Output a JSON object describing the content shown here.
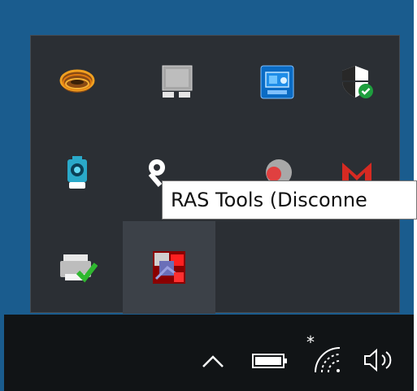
{
  "tooltip": {
    "text": "RAS Tools (Disconne"
  },
  "tray_icons": [
    {
      "name": "ring-app-icon"
    },
    {
      "name": "network-display-icon"
    },
    {
      "name": "intel-graphics-icon"
    },
    {
      "name": "windows-security-icon"
    },
    {
      "name": "webcam-icon"
    },
    {
      "name": "usb-device-icon"
    },
    {
      "name": "sync-app-icon"
    },
    {
      "name": "gmail-icon"
    },
    {
      "name": "printer-ok-icon"
    },
    {
      "name": "ras-tools-icon"
    }
  ],
  "taskbar": {
    "chevron": "show-hidden-icons",
    "battery": "battery-icon",
    "wifi": "wifi-icon",
    "wifi_flag": "*",
    "volume": "volume-icon"
  },
  "colors": {
    "desktop": "#1a5c8e",
    "panel": "#2b2f34",
    "taskbar": "#111416",
    "hover": "#3c4148"
  }
}
